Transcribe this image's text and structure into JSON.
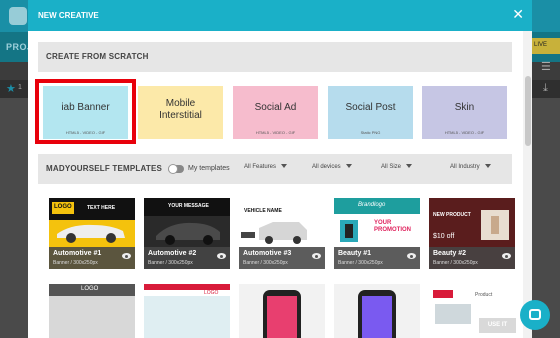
{
  "app": {
    "project_label": "PROJ",
    "row_count": "1",
    "topbar_button": "LIVE"
  },
  "modal": {
    "title": "NEW CREATIVE",
    "use_button": "USE IT"
  },
  "scratch": {
    "title": "CREATE FROM SCRATCH",
    "formats": [
      {
        "label": "iab Banner",
        "sub": "HTML5 - VIDEO - GIF",
        "color": "#b3e6f0"
      },
      {
        "label": "Mobile\nInterstitial",
        "sub": "",
        "color": "#fce9a9"
      },
      {
        "label": "Social Ad",
        "sub": "HTML5 - VIDEO - GIF",
        "color": "#f6bccd"
      },
      {
        "label": "Social Post",
        "sub": "Static PNG",
        "color": "#b6dced"
      },
      {
        "label": "Skin",
        "sub": "HTML5 - VIDEO - GIF",
        "color": "#c6c6e4"
      }
    ]
  },
  "templates": {
    "title": "MADYOURSELF TEMPLATES",
    "my_templates_label": "My templates",
    "filters": [
      "All Features",
      "All devices",
      "All Size",
      "All Industry"
    ],
    "items": [
      {
        "name": "Automotive #1",
        "size": "Banner / 300x250px",
        "headline": "TEXT HERE",
        "brand": "LOGO",
        "bg": "#f4c20d"
      },
      {
        "name": "Automotive #2",
        "size": "Banner / 300x250px",
        "headline": "YOUR MESSAGE",
        "brand": "",
        "bg": "#2a2a2a"
      },
      {
        "name": "Automotive #3",
        "size": "Banner / 300x250px",
        "headline": "VEHICLE NAME",
        "brand": "",
        "bg": "#ffffff"
      },
      {
        "name": "Beauty #1",
        "size": "Banner / 300x250px",
        "headline": "YOUR PROMOTION",
        "brand": "Brandlogo",
        "bg": "#ffffff"
      },
      {
        "name": "Beauty #2",
        "size": "Banner / 300x250px",
        "headline": "NEW PRODUCT",
        "brand": "$10 off",
        "bg": "#5a1d1d"
      }
    ],
    "row2": [
      {
        "label": "LOGO"
      },
      {
        "label": "LOGO"
      },
      {
        "label": ""
      },
      {
        "label": ""
      },
      {
        "label": "Product"
      }
    ]
  }
}
